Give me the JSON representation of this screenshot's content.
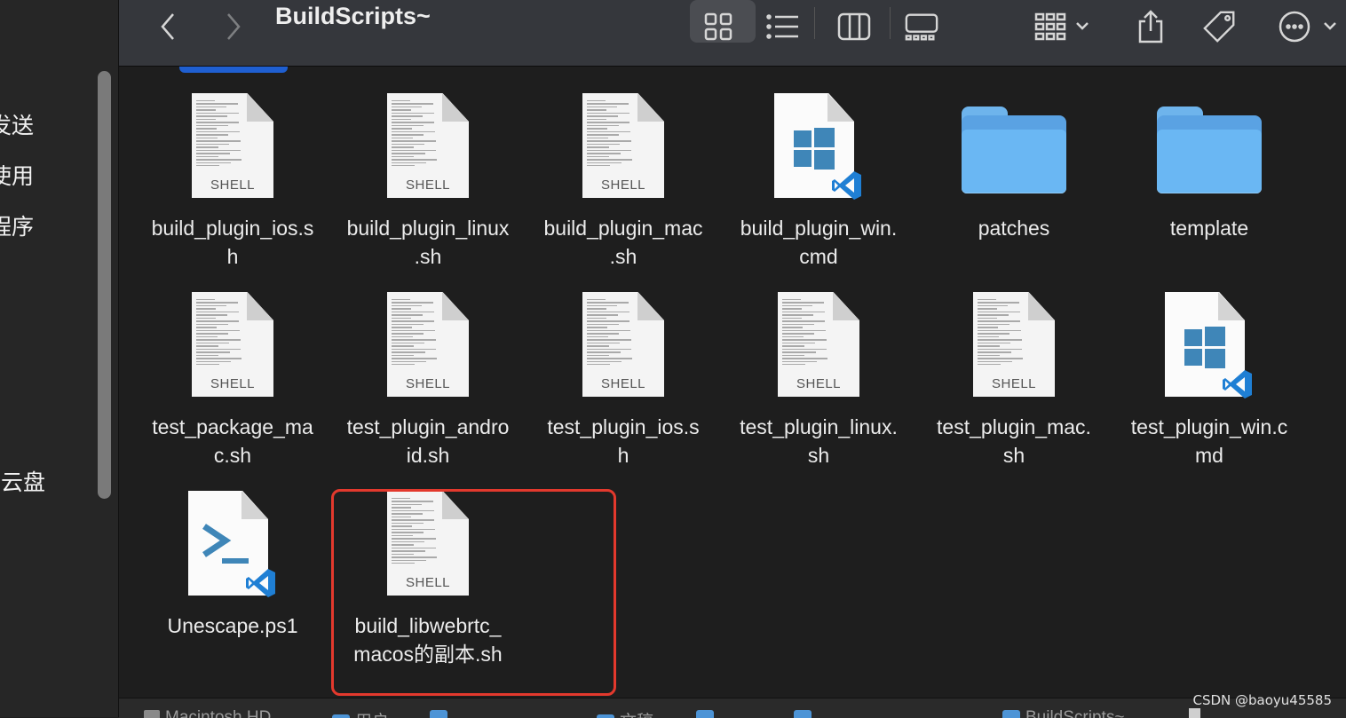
{
  "window": {
    "title": "BuildScripts~"
  },
  "sidebar": {
    "items": [
      {
        "label": "发送"
      },
      {
        "label": "使用"
      },
      {
        "label": "程序"
      },
      {
        "label": "网云盘"
      }
    ]
  },
  "toolbar": {
    "back_icon": "chevron-left-icon",
    "forward_icon": "chevron-right-icon",
    "views": [
      "icon-view",
      "list-view",
      "column-view",
      "gallery-view"
    ],
    "group_icon": "group-icon",
    "share_icon": "share-icon",
    "tag_icon": "tag-icon",
    "more_icon": "more-icon"
  },
  "cutoff_row": [
    "",
    "",
    "",
    "",
    "",
    ""
  ],
  "files": [
    {
      "name": "build_plugin_ios.s\nh",
      "kind": "shell",
      "tag": "SHELL"
    },
    {
      "name": "build_plugin_linux\n.sh",
      "kind": "shell",
      "tag": "SHELL"
    },
    {
      "name": "build_plugin_mac\n.sh",
      "kind": "shell",
      "tag": "SHELL"
    },
    {
      "name": "build_plugin_win.\ncmd",
      "kind": "cmd"
    },
    {
      "name": "patches",
      "kind": "folder"
    },
    {
      "name": "template",
      "kind": "folder"
    },
    {
      "name": "test_package_ma\nc.sh",
      "kind": "shell",
      "tag": "SHELL"
    },
    {
      "name": "test_plugin_andro\nid.sh",
      "kind": "shell",
      "tag": "SHELL"
    },
    {
      "name": "test_plugin_ios.s\nh",
      "kind": "shell",
      "tag": "SHELL"
    },
    {
      "name": "test_plugin_linux.\nsh",
      "kind": "shell",
      "tag": "SHELL"
    },
    {
      "name": "test_plugin_mac.\nsh",
      "kind": "shell",
      "tag": "SHELL"
    },
    {
      "name": "test_plugin_win.c\nmd",
      "kind": "cmd"
    },
    {
      "name": "Unescape.ps1",
      "kind": "ps1"
    },
    {
      "name": "build_libwebrtc_\nmacos的副本.sh",
      "kind": "shell",
      "tag": "SHELL",
      "highlighted": true
    }
  ],
  "pathbar": [
    "Macintosh HD",
    "用户",
    "",
    "文稿",
    "",
    "",
    "BuildScripts~",
    ""
  ],
  "watermark": "CSDN @baoyu45585",
  "colors": {
    "highlight": "#e3392d",
    "folder": "#6ab7f3",
    "selection": "#1f5fd1"
  }
}
